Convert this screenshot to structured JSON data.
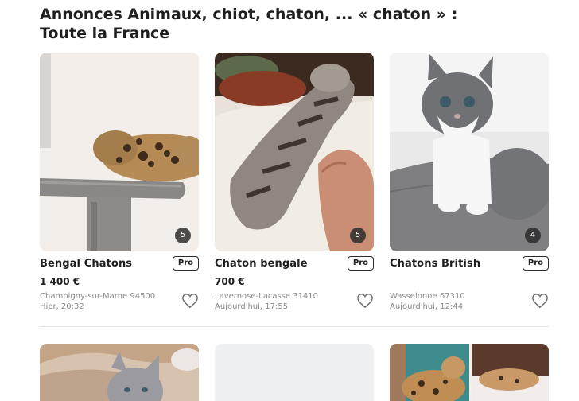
{
  "page": {
    "title_line1": "Annonces Animaux, chiot, chaton, ... « chaton » :",
    "title_line2": "Toute la France"
  },
  "listings": [
    {
      "title": "Bengal Chatons",
      "badge": "Pro",
      "price": "1 400 €",
      "location": "Champigny-sur-Marne 94500",
      "date": "Hier, 20:32",
      "photo_count": "5",
      "image": "bengal-kitten-on-cat-tree"
    },
    {
      "title": "Chaton bengale",
      "badge": "Pro",
      "price": "700 €",
      "location": "Lavernose-Lacasse 31410",
      "date": "Aujourd'hui, 17:55",
      "photo_count": "5",
      "image": "bengal-kitten-held-by-hand"
    },
    {
      "title": "Chatons British",
      "badge": "Pro",
      "price": "",
      "location": "Wasselonne 67310",
      "date": "Aujourd'hui, 12:44",
      "photo_count": "4",
      "image": "grey-white-british-kitten"
    }
  ],
  "icons": {
    "favorite": "heart-outline-icon"
  },
  "colors": {
    "text": "#1f1f1f",
    "muted": "#8a8a8a",
    "divider": "#e4e4e4",
    "count_bg": "#282828"
  }
}
